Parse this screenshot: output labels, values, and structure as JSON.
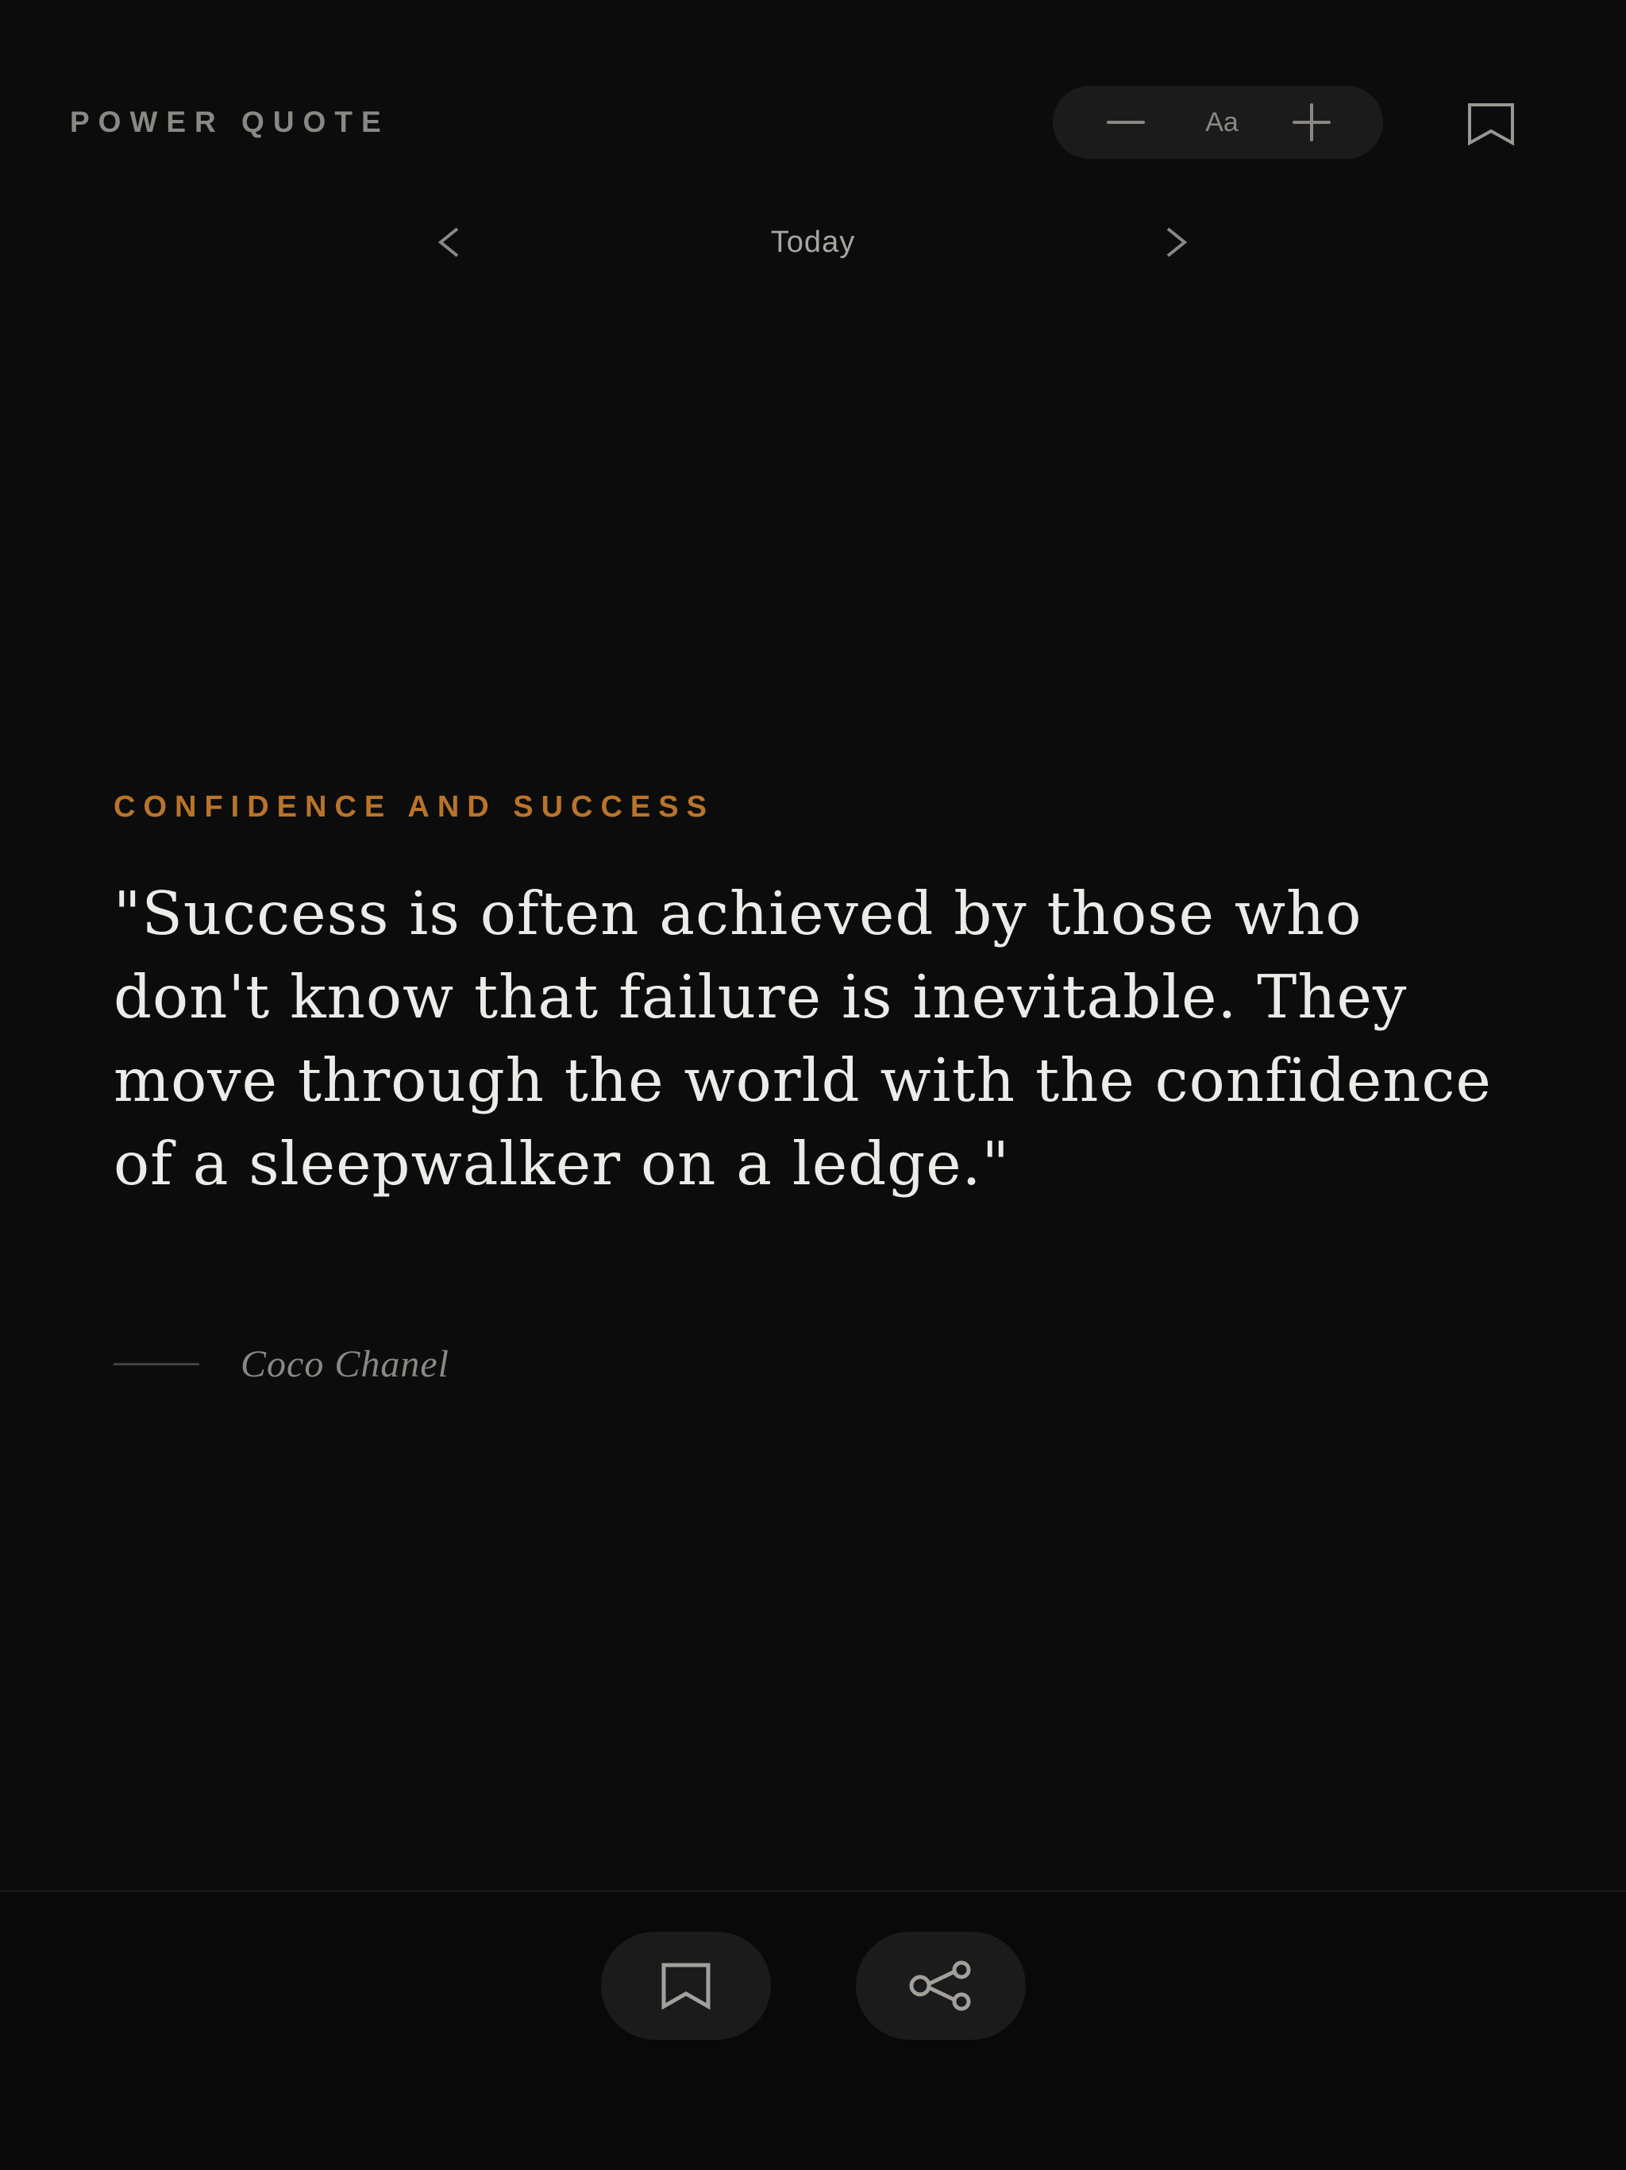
{
  "header": {
    "brand": "POWER QUOTE",
    "font_size_label": "Aa",
    "icons": {
      "decrease": "minus-icon",
      "increase": "plus-icon",
      "bookmarks": "bookmark-icon"
    }
  },
  "nav": {
    "title": "Today",
    "prev_icon": "chevron-left-icon",
    "next_icon": "chevron-right-icon"
  },
  "quote": {
    "category": "CONFIDENCE AND SUCCESS",
    "text": "\"Success is often achieved by those who don't know that failure is inevitable. They move through the world with the confidence of a sleepwalker on a ledge.\"",
    "author": "Coco Chanel"
  },
  "footer": {
    "save_icon": "bookmark-icon",
    "share_icon": "share-icon"
  },
  "colors": {
    "background": "#0c0c0c",
    "accent": "#b9742a",
    "text": "#ecebe8",
    "muted": "#8b8884",
    "pill": "#1b1b1b"
  }
}
